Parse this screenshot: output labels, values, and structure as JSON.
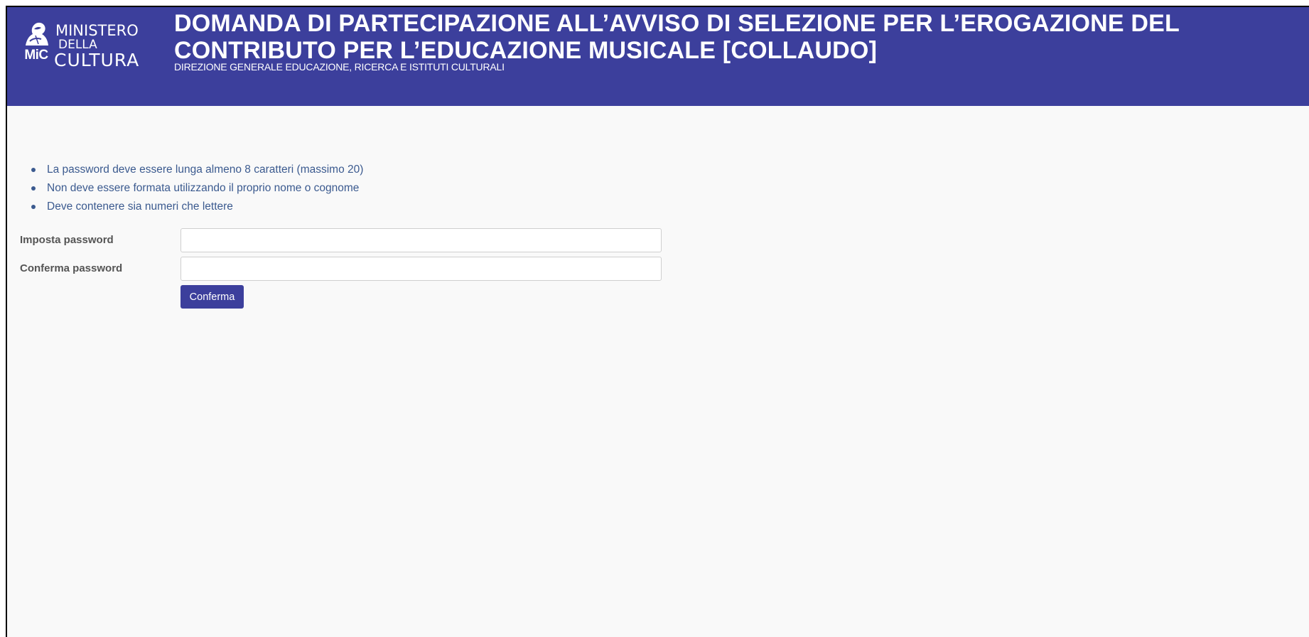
{
  "header": {
    "logo": {
      "badge": "MiC",
      "line1": "MINISTERO",
      "line2": "DELLA",
      "line3": "CULTURA",
      "icon": "ministry-emblem-icon"
    },
    "title": "DOMANDA DI PARTECIPAZIONE ALL’AVVISO DI SELEZIONE PER L’EROGAZIONE DEL CONTRIBUTO PER L’EDUCAZIONE MUSICALE [COLLAUDO]",
    "subtitle": "DIREZIONE GENERALE EDUCAZIONE, RICERCA E ISTITUTI CULTURALI",
    "background_color": "#3c3f9c"
  },
  "password_rules": [
    "La password deve essere lunga almeno 8 caratteri (massimo 20)",
    "Non deve essere formata utilizzando il proprio nome o cognome",
    "Deve contenere sia numeri che lettere"
  ],
  "form": {
    "set_password": {
      "label": "Imposta password",
      "value": "",
      "placeholder": ""
    },
    "confirm_password": {
      "label": "Conferma password",
      "value": "",
      "placeholder": ""
    },
    "submit_label": "Conferma"
  },
  "colors": {
    "accent": "#3c3f9c",
    "rule_text": "#3b5a8f",
    "page_background": "#f9f9f9"
  }
}
